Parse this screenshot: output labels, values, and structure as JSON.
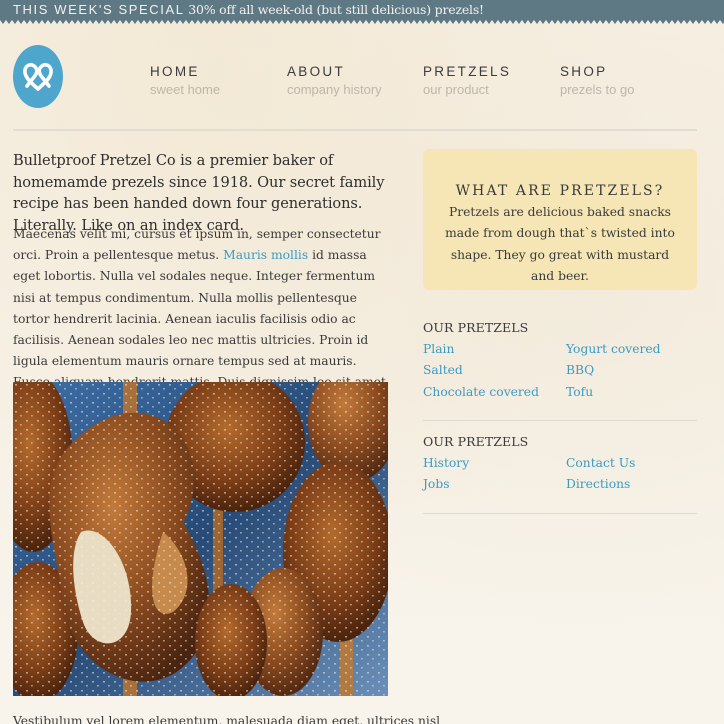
{
  "promo": {
    "label": "THIS WEEK'S SPECIAL",
    "text": "30% off all week-old (but still delicious) prezels!"
  },
  "logo": {
    "icon": "pretzel-icon",
    "color": "#4fa6cc"
  },
  "nav": [
    {
      "title": "HOME",
      "sub": "sweet home"
    },
    {
      "title": "ABOUT",
      "sub": "company history"
    },
    {
      "title": "PRETZELS",
      "sub": "our product"
    },
    {
      "title": "SHOP",
      "sub": "prezels to go"
    }
  ],
  "main": {
    "intro": "Bulletproof Pretzel Co is a premier baker of homemamde prezels since 1918. Our secret family recipe has been handed down four generations. Literally. Like on an index card.",
    "body_before_link": "Maecenas velit mi, cursus et ipsum in, semper consectetur orci. Proin a pellentesque metus. ",
    "body_link": "Mauris mollis",
    "body_after_link": " id massa eget lobortis. Nulla vel sodales neque. Integer fermentum nisi at tempus condimentum. Nulla mollis pellentesque tortor hendrerit lacinia. Aenean iaculis facilisis odio ac facilisis. Aenean sodales leo nec mattis ultricies. Proin id ligula elementum mauris ornare tempus sed at mauris. Fusce aliquam hendrerit mattis. Duis dignissim leo sit amet nulla viverra facilisis.",
    "photo": "pretzels-photo",
    "footer_text": "Vestibulum vel lorem elementum, malesuada diam eget, ultrices nisl"
  },
  "sidebar": {
    "info_title": "WHAT ARE PRETZELS?",
    "info_text": "Pretzels are delicious baked snacks made from dough that`s twisted into shape. They go great with mustard and beer.",
    "section1": {
      "heading": "OUR PRETZELS",
      "links": [
        "Plain",
        "Yogurt covered",
        "Salted",
        "BBQ",
        "Chocolate covered",
        "Tofu"
      ]
    },
    "section2": {
      "heading": "OUR PRETZELS",
      "links": [
        "History",
        "Contact Us",
        "Jobs",
        "Directions"
      ]
    }
  },
  "colors": {
    "accent": "#3a9bc3",
    "topbar": "#5e7884",
    "infobox": "#f6e6b6",
    "background": "#f7f1e6"
  }
}
